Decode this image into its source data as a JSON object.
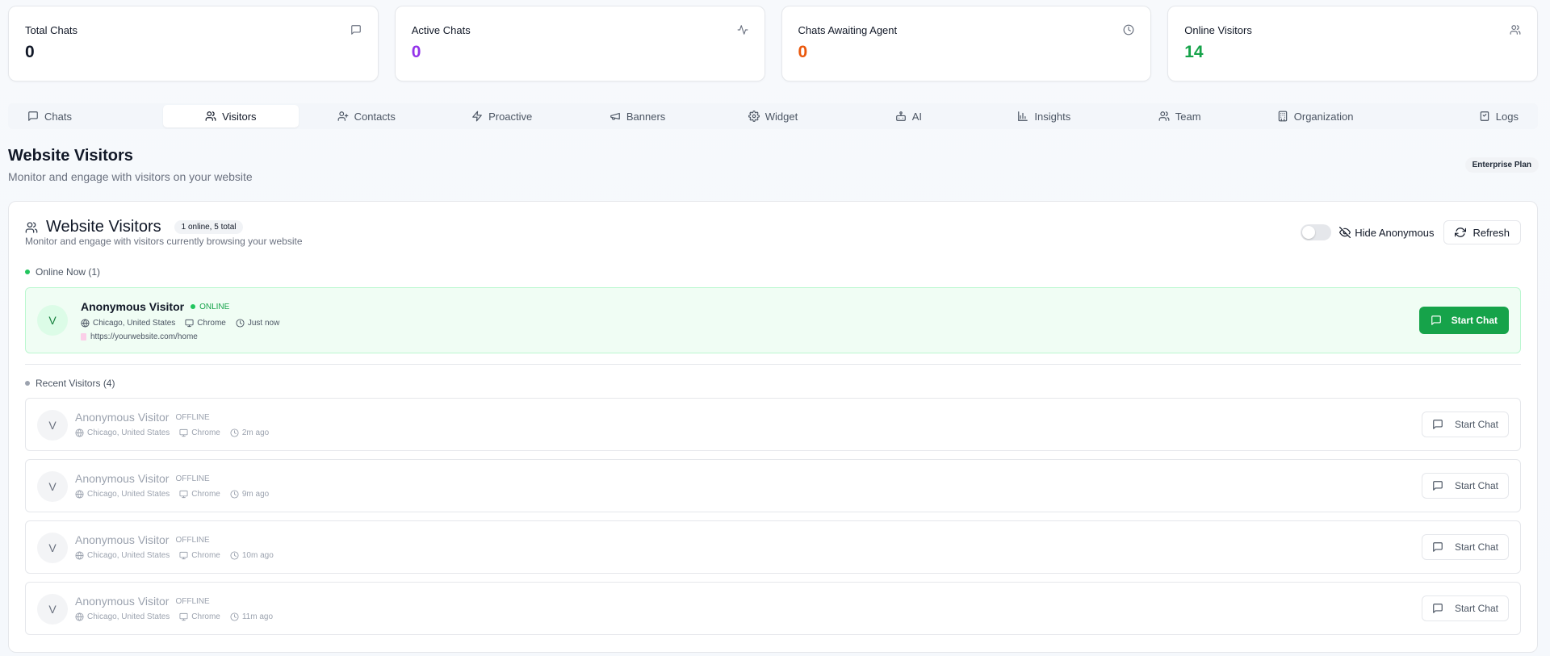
{
  "stats": [
    {
      "label": "Total Chats",
      "value": "0",
      "icon": "message-square-icon",
      "color": "#111827"
    },
    {
      "label": "Active Chats",
      "value": "0",
      "icon": "activity-icon",
      "color": "#9333ea"
    },
    {
      "label": "Chats Awaiting Agent",
      "value": "0",
      "icon": "clock-icon",
      "color": "#ea580c"
    },
    {
      "label": "Online Visitors",
      "value": "14",
      "icon": "users-icon",
      "color": "#16a34a"
    }
  ],
  "tabs": [
    {
      "label": "Chats",
      "icon": "message-square-icon"
    },
    {
      "label": "Visitors",
      "icon": "users-icon",
      "active": true
    },
    {
      "label": "Contacts",
      "icon": "user-plus-icon"
    },
    {
      "label": "Proactive",
      "icon": "zap-icon"
    },
    {
      "label": "Banners",
      "icon": "megaphone-icon"
    },
    {
      "label": "Widget",
      "icon": "gear-icon"
    },
    {
      "label": "AI",
      "icon": "bot-icon"
    },
    {
      "label": "Insights",
      "icon": "bar-chart-icon"
    },
    {
      "label": "Team",
      "icon": "users-icon"
    },
    {
      "label": "Organization",
      "icon": "building-icon"
    },
    {
      "label": "Logs",
      "icon": "file-icon"
    }
  ],
  "page": {
    "title": "Website Visitors",
    "subtitle": "Monitor and engage with visitors on your website",
    "plan": "Enterprise Plan"
  },
  "panel": {
    "title": "Website Visitors",
    "count_badge": "1 online, 5 total",
    "subtitle": "Monitor and engage with visitors currently browsing your website",
    "hide_anonymous_label": "Hide Anonymous",
    "hide_anonymous_on": false,
    "refresh_label": "Refresh"
  },
  "online_section": {
    "label": "Online Now (1)",
    "visitors": [
      {
        "initial": "V",
        "name": "Anonymous Visitor",
        "status": "ONLINE",
        "location": "Chicago, United States",
        "browser": "Chrome",
        "time": "Just now",
        "url": "https://yourwebsite.com/home",
        "action": "Start Chat"
      }
    ]
  },
  "recent_section": {
    "label": "Recent Visitors (4)",
    "visitors": [
      {
        "initial": "V",
        "name": "Anonymous Visitor",
        "status": "OFFLINE",
        "location": "Chicago, United States",
        "browser": "Chrome",
        "time": "2m ago",
        "action": "Start Chat"
      },
      {
        "initial": "V",
        "name": "Anonymous Visitor",
        "status": "OFFLINE",
        "location": "Chicago, United States",
        "browser": "Chrome",
        "time": "9m ago",
        "action": "Start Chat"
      },
      {
        "initial": "V",
        "name": "Anonymous Visitor",
        "status": "OFFLINE",
        "location": "Chicago, United States",
        "browser": "Chrome",
        "time": "10m ago",
        "action": "Start Chat"
      },
      {
        "initial": "V",
        "name": "Anonymous Visitor",
        "status": "OFFLINE",
        "location": "Chicago, United States",
        "browser": "Chrome",
        "time": "11m ago",
        "action": "Start Chat"
      }
    ]
  },
  "colors": {
    "online": "#16a34a",
    "offline_dot": "#9ca3af",
    "accent": "#16a34a"
  }
}
